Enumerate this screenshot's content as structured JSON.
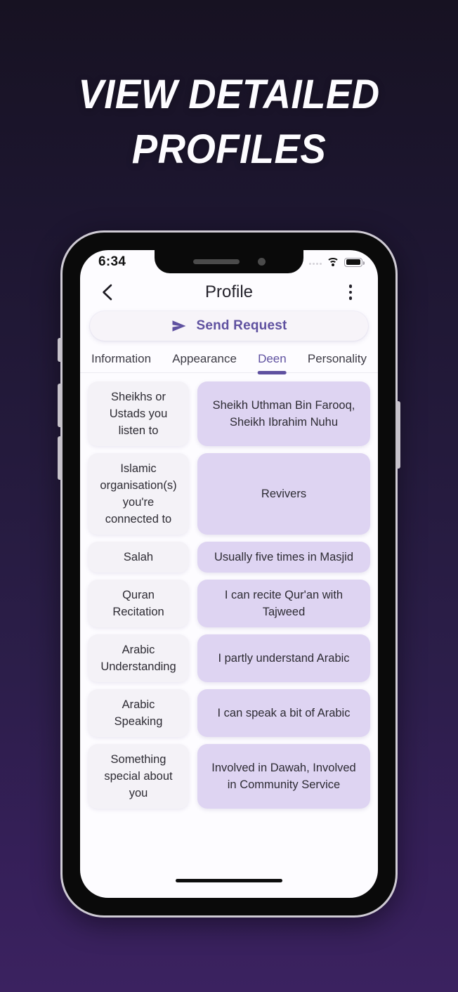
{
  "promo": {
    "headline_line1": "VIEW DETAILED",
    "headline_line2": "PROFILES"
  },
  "theme": {
    "accent": "#5f51a0",
    "value_card_bg": "#ded4f2",
    "label_card_bg": "#f4f2f7",
    "bg_top": "#171222",
    "bg_bottom": "#3b2260"
  },
  "status_bar": {
    "time": "6:34",
    "signal_icon": "signal-dots-icon",
    "wifi_icon": "wifi-icon",
    "battery_icon": "battery-full-icon"
  },
  "nav": {
    "back_icon": "chevron-left-icon",
    "title": "Profile",
    "more_icon": "more-vertical-icon"
  },
  "send_request": {
    "icon": "send-icon",
    "label": "Send Request"
  },
  "tabs": [
    {
      "label": "Information",
      "active": false
    },
    {
      "label": "Appearance",
      "active": false
    },
    {
      "label": "Deen",
      "active": true
    },
    {
      "label": "Personality",
      "active": false
    }
  ],
  "deen_rows": [
    {
      "label": "Sheikhs or Ustads you listen to",
      "value": "Sheikh Uthman Bin Farooq, Sheikh Ibrahim Nuhu"
    },
    {
      "label": "Islamic organisation(s) you're connected to",
      "value": "Revivers"
    },
    {
      "label": "Salah",
      "value": "Usually five times in Masjid"
    },
    {
      "label": "Quran Recitation",
      "value": "I can recite Qur'an with Tajweed"
    },
    {
      "label": "Arabic Understanding",
      "value": "I partly understand Arabic"
    },
    {
      "label": "Arabic Speaking",
      "value": "I can speak a bit of Arabic"
    },
    {
      "label": "Something special about you",
      "value": "Involved in Dawah, Involved in Community Service"
    }
  ]
}
